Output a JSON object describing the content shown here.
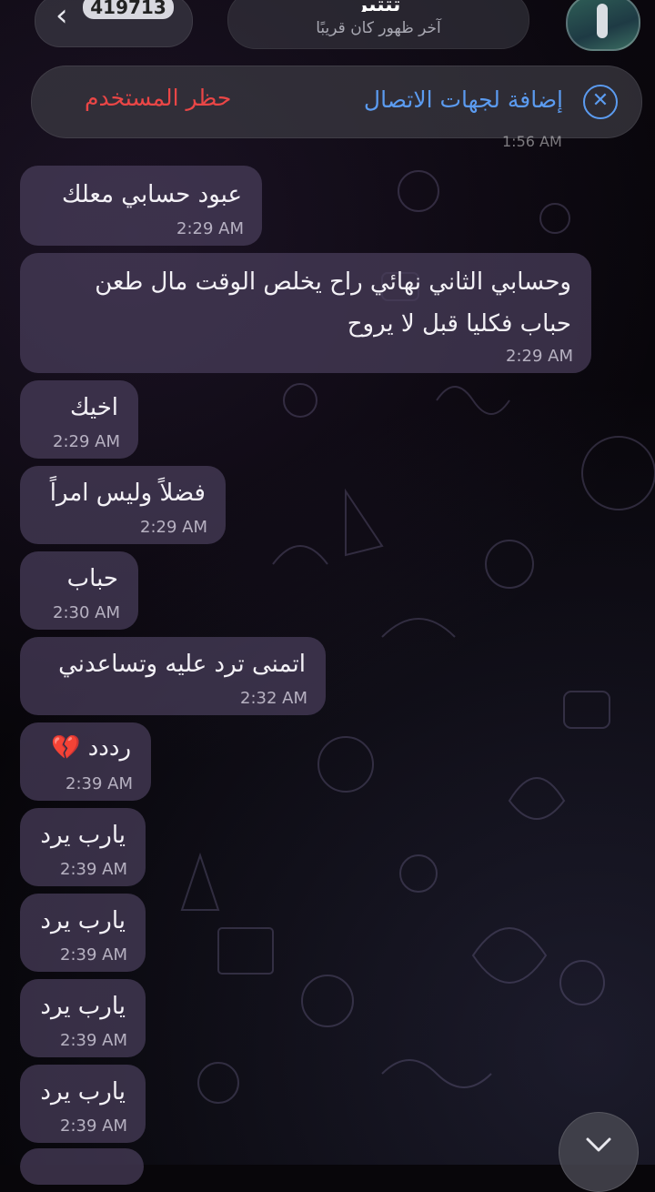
{
  "header": {
    "unread_count": "419713",
    "chat_name": "تتتبر",
    "last_seen": "آخر ظهور كان قريبًا"
  },
  "action_bar": {
    "add_to_contacts": "إضافة لجهات الاتصال",
    "block_user": "حظر المستخدم"
  },
  "partial_time": "1:56 AM",
  "messages": [
    {
      "text": "عبود حسابي معلك",
      "time": "2:29 AM"
    },
    {
      "line1": "وحسابي الثاني نهائي راح يخلص الوقت مال طعن",
      "line2": "حباب فكليا قبل لا يروح",
      "time": "2:29 AM"
    },
    {
      "text": "اخيك",
      "time": "2:29 AM"
    },
    {
      "text": "فضلاً وليس امراً",
      "time": "2:29 AM"
    },
    {
      "text": "حباب",
      "time": "2:30 AM"
    },
    {
      "text": "اتمنى ترد عليه وتساعدني",
      "time": "2:32 AM"
    },
    {
      "text": "رددد",
      "emoji": "💔",
      "time": "2:39 AM"
    },
    {
      "text": "يارب يرد",
      "time": "2:39 AM"
    },
    {
      "text": "يارب يرد",
      "time": "2:39 AM"
    },
    {
      "text": "يارب يرد",
      "time": "2:39 AM"
    },
    {
      "text": "يارب يرد",
      "time": "2:39 AM"
    }
  ],
  "colors": {
    "accent_blue": "#5b9bf0",
    "danger_red": "#ea4646",
    "bubble": "#4a3e5c"
  }
}
